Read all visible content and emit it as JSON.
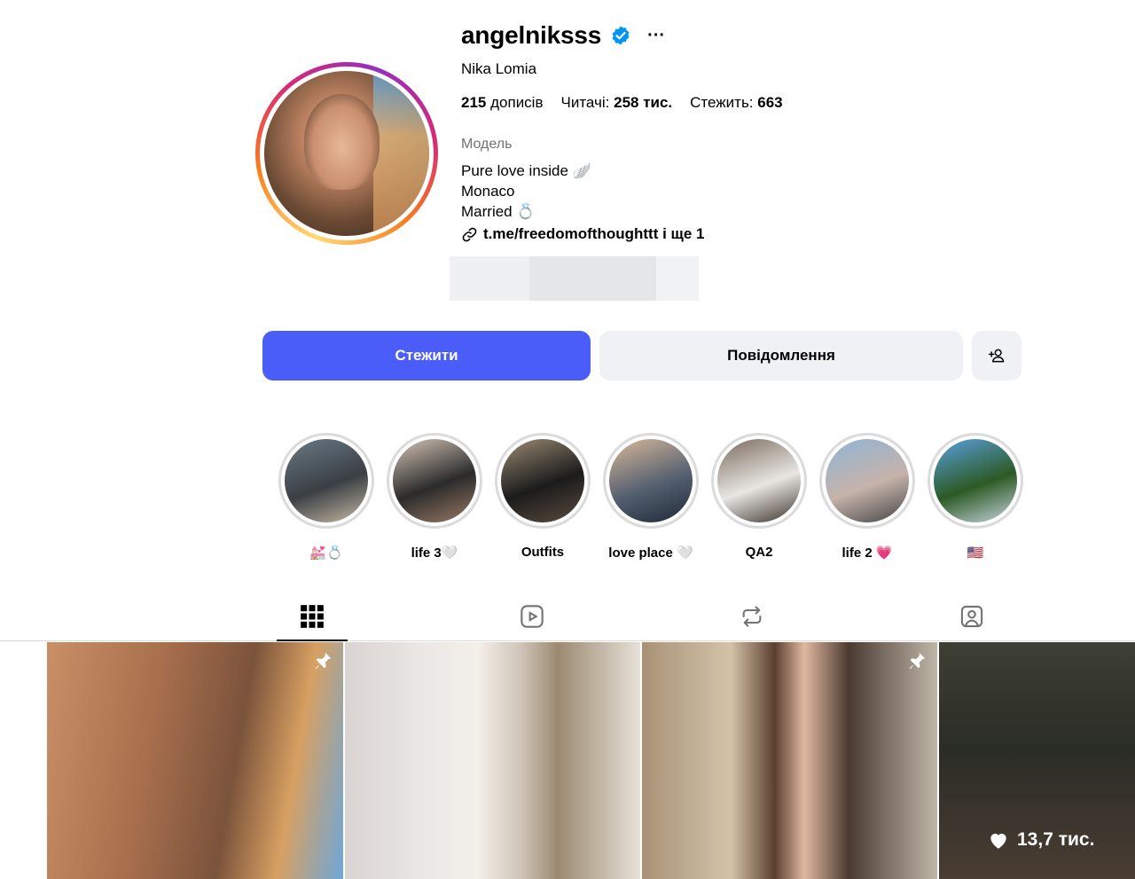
{
  "profile": {
    "username": "angelniksss",
    "full_name": "Nika Lomia",
    "more_label": "···",
    "stats": {
      "posts_count": "215",
      "posts_label": "дописів",
      "followers_label": "Читачі:",
      "followers_count": "258 тис.",
      "following_label": "Стежить:",
      "following_count": "663"
    },
    "category": "Модель",
    "bio": [
      "Pure love inside 🪽",
      "Monaco",
      "Married 💍"
    ],
    "link": "t.me/freedomofthoughttt і ще 1"
  },
  "actions": {
    "follow_label": "Стежити",
    "message_label": "Повідомлення"
  },
  "highlights": [
    {
      "label": "💒💍",
      "colors": [
        "#6a7a86",
        "#3a3f44",
        "#c7b9a5"
      ]
    },
    {
      "label": "life 3🤍",
      "colors": [
        "#d6c6b8",
        "#2b2b2b",
        "#9a7a66"
      ]
    },
    {
      "label": "Outfits",
      "colors": [
        "#9c8b74",
        "#1b1b1b",
        "#5c4b3f"
      ]
    },
    {
      "label": "love place 🤍",
      "colors": [
        "#d9b999",
        "#556070",
        "#1f2a38"
      ]
    },
    {
      "label": "QA2",
      "colors": [
        "#7a6a5e",
        "#e8e6e2",
        "#3a302a"
      ]
    },
    {
      "label": "life 2 💗",
      "colors": [
        "#8fb4d6",
        "#c6b3aa",
        "#444"
      ]
    },
    {
      "label": "🇺🇸",
      "colors": [
        "#5aa0e0",
        "#2c5a24",
        "#c9d6e0"
      ]
    }
  ],
  "tabs": [
    {
      "icon": "grid-icon",
      "active": true
    },
    {
      "icon": "reels-icon",
      "active": false
    },
    {
      "icon": "reposts-icon",
      "active": false
    },
    {
      "icon": "tagged-icon",
      "active": false
    }
  ],
  "posts": [
    {
      "pinned": true
    },
    {
      "pinned": false
    },
    {
      "pinned": true
    },
    {
      "pinned": false,
      "likes": "13,7 тис."
    }
  ],
  "colors": {
    "follow_button": "#4a5df9",
    "secondary_button": "#eff1f5",
    "verified": "#0095f6",
    "muted_text": "#737373"
  }
}
